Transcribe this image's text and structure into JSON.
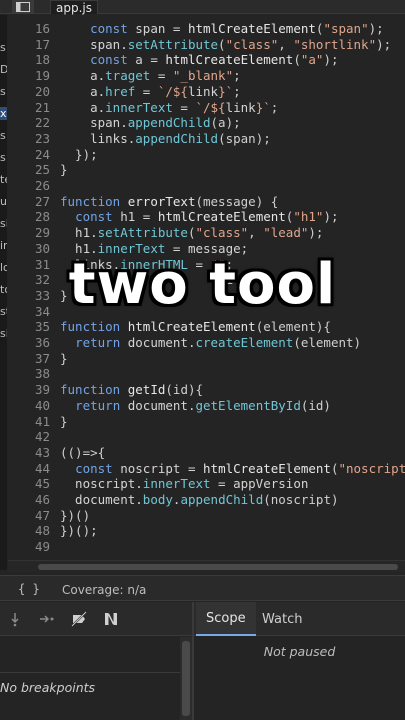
{
  "tab": {
    "file_name": "app.js",
    "icon": "sidebar-toggle-icon"
  },
  "left_tree": {
    "fragments": [
      "s",
      "D",
      "s",
      "x",
      "s",
      "s",
      "te",
      "u",
      "si",
      "in",
      "lo",
      "to",
      "st",
      "si"
    ]
  },
  "editor": {
    "lines": [
      {
        "n": "16",
        "tokens": [
          [
            "    ",
            ""
          ],
          [
            "const",
            "kw"
          ],
          [
            " span = ",
            ""
          ],
          [
            "htmlCreateElement",
            "fn"
          ],
          [
            "(",
            "punc"
          ],
          [
            "\"span\"",
            "str"
          ],
          [
            ");",
            "punc"
          ]
        ]
      },
      {
        "n": "17",
        "tokens": [
          [
            "    span.",
            ""
          ],
          [
            "setAttribute",
            "prop"
          ],
          [
            "(",
            "punc"
          ],
          [
            "\"class\"",
            "str"
          ],
          [
            ", ",
            "punc"
          ],
          [
            "\"shortlink\"",
            "str"
          ],
          [
            ");",
            "punc"
          ]
        ]
      },
      {
        "n": "18",
        "tokens": [
          [
            "    ",
            ""
          ],
          [
            "const",
            "kw"
          ],
          [
            " a = ",
            ""
          ],
          [
            "htmlCreateElement",
            "fn"
          ],
          [
            "(",
            "punc"
          ],
          [
            "\"a\"",
            "str"
          ],
          [
            ");",
            "punc"
          ]
        ]
      },
      {
        "n": "19",
        "tokens": [
          [
            "    a.",
            ""
          ],
          [
            "traget",
            "prop"
          ],
          [
            " = ",
            ""
          ],
          [
            "\"_blank\"",
            "str"
          ],
          [
            ";",
            "punc"
          ]
        ]
      },
      {
        "n": "20",
        "tokens": [
          [
            "    a.",
            ""
          ],
          [
            "href",
            "prop"
          ],
          [
            " = ",
            ""
          ],
          [
            "`/${",
            "str"
          ],
          [
            "link",
            ""
          ],
          [
            "}`",
            "str"
          ],
          [
            ";",
            "punc"
          ]
        ]
      },
      {
        "n": "21",
        "tokens": [
          [
            "    a.",
            ""
          ],
          [
            "innerText",
            "prop"
          ],
          [
            " = ",
            ""
          ],
          [
            "`/${",
            "str"
          ],
          [
            "link",
            ""
          ],
          [
            "}`",
            "str"
          ],
          [
            ";",
            "punc"
          ]
        ]
      },
      {
        "n": "22",
        "tokens": [
          [
            "    span.",
            ""
          ],
          [
            "appendChild",
            "prop"
          ],
          [
            "(a);",
            "punc"
          ]
        ]
      },
      {
        "n": "23",
        "tokens": [
          [
            "    links.",
            ""
          ],
          [
            "appendChild",
            "prop"
          ],
          [
            "(span);",
            "punc"
          ]
        ]
      },
      {
        "n": "24",
        "tokens": [
          [
            "  });",
            "punc"
          ]
        ]
      },
      {
        "n": "25",
        "tokens": [
          [
            "}",
            "punc"
          ]
        ]
      },
      {
        "n": "26",
        "tokens": []
      },
      {
        "n": "27",
        "tokens": [
          [
            "function",
            "kw"
          ],
          [
            " ",
            ""
          ],
          [
            "errorText",
            "fn"
          ],
          [
            "(message) {",
            "punc"
          ]
        ]
      },
      {
        "n": "28",
        "tokens": [
          [
            "  ",
            ""
          ],
          [
            "const",
            "kw"
          ],
          [
            " h1 = ",
            ""
          ],
          [
            "htmlCreateElement",
            "fn"
          ],
          [
            "(",
            "punc"
          ],
          [
            "\"h1\"",
            "str"
          ],
          [
            ");",
            "punc"
          ]
        ]
      },
      {
        "n": "29",
        "tokens": [
          [
            "  h1.",
            ""
          ],
          [
            "setAttribute",
            "prop"
          ],
          [
            "(",
            "punc"
          ],
          [
            "\"class\"",
            "str"
          ],
          [
            ", ",
            "punc"
          ],
          [
            "\"lead\"",
            "str"
          ],
          [
            ");",
            "punc"
          ]
        ]
      },
      {
        "n": "30",
        "tokens": [
          [
            "  h1.",
            ""
          ],
          [
            "innerText",
            "prop"
          ],
          [
            " = message;",
            ""
          ]
        ]
      },
      {
        "n": "31",
        "tokens": [
          [
            "  links.",
            ""
          ],
          [
            "innerHTML",
            "prop"
          ],
          [
            " = ",
            ""
          ],
          [
            "\"\"",
            "str"
          ],
          [
            ";",
            "punc"
          ]
        ]
      },
      {
        "n": "32",
        "tokens": [
          [
            "                    (h1",
            ""
          ]
        ]
      },
      {
        "n": "33",
        "tokens": [
          [
            "}",
            "punc"
          ]
        ]
      },
      {
        "n": "34",
        "tokens": []
      },
      {
        "n": "35",
        "tokens": [
          [
            "function",
            "kw"
          ],
          [
            " ",
            ""
          ],
          [
            "htmlCreateElement",
            "fn"
          ],
          [
            "(element){",
            "punc"
          ]
        ]
      },
      {
        "n": "36",
        "tokens": [
          [
            "  ",
            ""
          ],
          [
            "return",
            "kw"
          ],
          [
            " document.",
            ""
          ],
          [
            "createElement",
            "prop"
          ],
          [
            "(element)",
            "punc"
          ]
        ]
      },
      {
        "n": "37",
        "tokens": [
          [
            "}",
            "punc"
          ]
        ]
      },
      {
        "n": "38",
        "tokens": []
      },
      {
        "n": "39",
        "tokens": [
          [
            "function",
            "kw"
          ],
          [
            " ",
            ""
          ],
          [
            "getId",
            "fn"
          ],
          [
            "(id){",
            "punc"
          ]
        ]
      },
      {
        "n": "40",
        "tokens": [
          [
            "  ",
            ""
          ],
          [
            "return",
            "kw"
          ],
          [
            " document.",
            ""
          ],
          [
            "getElementById",
            "prop"
          ],
          [
            "(id)",
            "punc"
          ]
        ]
      },
      {
        "n": "41",
        "tokens": [
          [
            "}",
            "punc"
          ]
        ]
      },
      {
        "n": "42",
        "tokens": []
      },
      {
        "n": "43",
        "tokens": [
          [
            "(()=>{",
            "punc"
          ]
        ]
      },
      {
        "n": "44",
        "tokens": [
          [
            "  ",
            ""
          ],
          [
            "const",
            "kw"
          ],
          [
            " noscript = ",
            ""
          ],
          [
            "htmlCreateElement",
            "fn"
          ],
          [
            "(",
            "punc"
          ],
          [
            "\"noscript\"",
            "str"
          ],
          [
            ")",
            "punc"
          ]
        ]
      },
      {
        "n": "45",
        "tokens": [
          [
            "  noscript.",
            ""
          ],
          [
            "innerText",
            "prop"
          ],
          [
            " = appVersion",
            ""
          ]
        ]
      },
      {
        "n": "46",
        "tokens": [
          [
            "  document.",
            ""
          ],
          [
            "body",
            "prop"
          ],
          [
            ".",
            ""
          ],
          [
            "appendChild",
            "prop"
          ],
          [
            "(noscript)",
            "punc"
          ]
        ]
      },
      {
        "n": "47",
        "tokens": [
          [
            "})()",
            "punc"
          ]
        ]
      },
      {
        "n": "48",
        "tokens": [
          [
            "})();",
            "punc"
          ]
        ]
      },
      {
        "n": "49",
        "tokens": []
      }
    ]
  },
  "overlay": {
    "caption": "two tool"
  },
  "status_bar": {
    "braces": "{ }",
    "coverage": "Coverage: n/a"
  },
  "debugger": {
    "buttons": [
      "step-into-icon",
      "step-icon",
      "deactivate-breakpoints-icon",
      "pause-on-exceptions-icon"
    ],
    "tabs": [
      {
        "label": "Scope",
        "active": true
      },
      {
        "label": "Watch",
        "active": false
      }
    ],
    "scope_message": "Not paused",
    "breakpoints_message": "No breakpoints"
  },
  "colors": {
    "keyword": "#73a3e6",
    "string": "#e1a58c",
    "property": "#6fc7d6",
    "background": "#242424"
  }
}
